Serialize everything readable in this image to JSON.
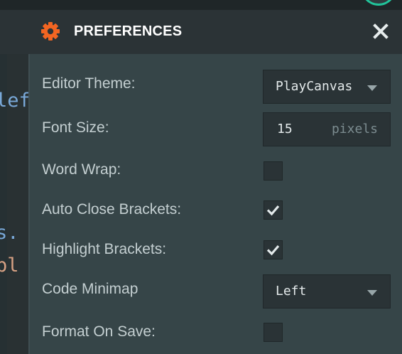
{
  "panel": {
    "title": "PREFERENCES",
    "icon": "gear-icon",
    "close_icon": "close-icon",
    "accent_color": "#f26522"
  },
  "code_fragments": [
    "lef",
    "s.",
    "pl"
  ],
  "settings": {
    "editor_theme": {
      "label": "Editor Theme:",
      "value": "PlayCanvas"
    },
    "font_size": {
      "label": "Font Size:",
      "value": "15",
      "unit": "pixels"
    },
    "word_wrap": {
      "label": "Word Wrap:",
      "checked": false
    },
    "auto_close_brackets": {
      "label": "Auto Close Brackets:",
      "checked": true
    },
    "highlight_brackets": {
      "label": "Highlight Brackets:",
      "checked": true
    },
    "code_minimap": {
      "label": "Code Minimap",
      "value": "Left"
    },
    "format_on_save": {
      "label": "Format On Save:",
      "checked": false
    }
  }
}
